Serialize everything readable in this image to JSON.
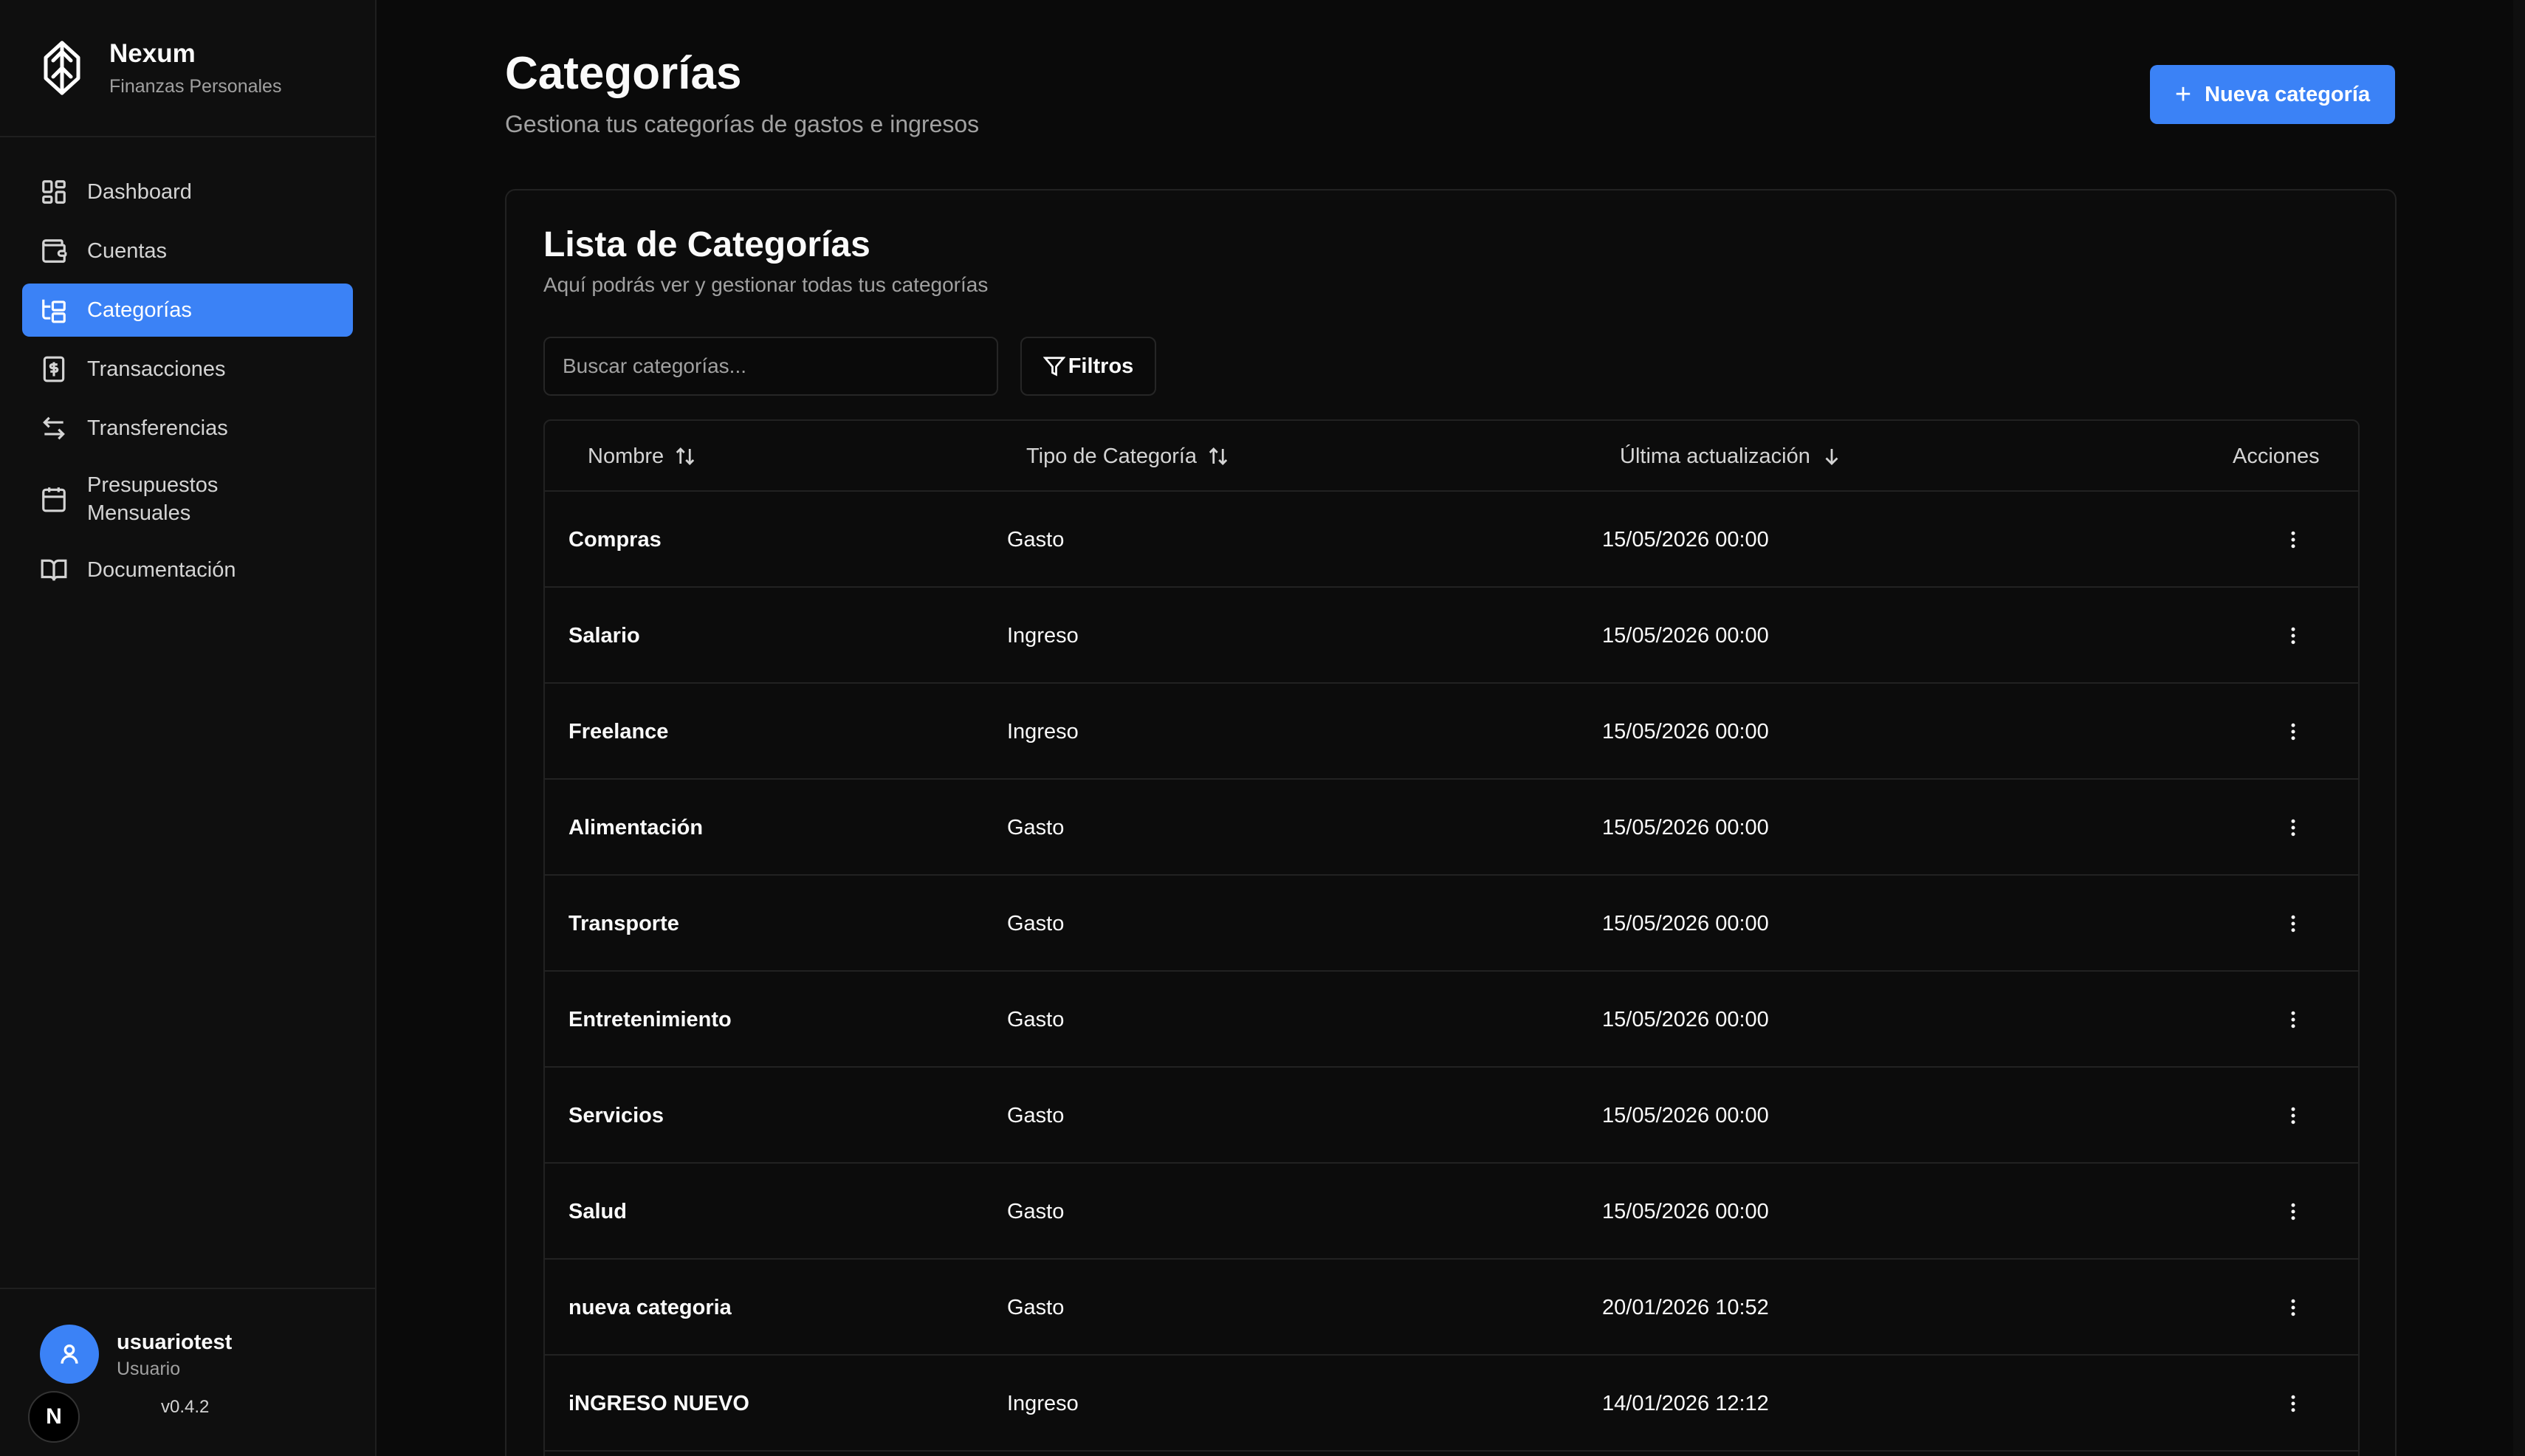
{
  "app": {
    "name": "Nexum",
    "subtitle": "Finanzas Personales",
    "version": "v0.4.2"
  },
  "sidebar": {
    "items": [
      {
        "label": "Dashboard",
        "icon": "dashboard-icon"
      },
      {
        "label": "Cuentas",
        "icon": "wallet-icon"
      },
      {
        "label": "Categorías",
        "icon": "tree-icon",
        "active": true
      },
      {
        "label": "Transacciones",
        "icon": "receipt-dollar-icon"
      },
      {
        "label": "Transferencias",
        "icon": "arrows-exchange-icon"
      },
      {
        "label": "Presupuestos\nMensuales",
        "icon": "calendar-icon"
      },
      {
        "label": "Documentación",
        "icon": "book-icon"
      }
    ]
  },
  "user": {
    "name": "usuariotest",
    "role": "Usuario",
    "badge": "N"
  },
  "page": {
    "title": "Categorías",
    "subtitle": "Gestiona tus categorías de gastos e ingresos",
    "new_button": "Nueva categoría"
  },
  "card": {
    "title": "Lista de Categorías",
    "subtitle": "Aquí podrás ver y gestionar todas tus categorías",
    "search_placeholder": "Buscar categorías...",
    "filters_label": "Filtros"
  },
  "table": {
    "columns": {
      "name": "Nombre",
      "type": "Tipo de Categoría",
      "updated": "Última actualización",
      "actions": "Acciones"
    },
    "rows": [
      {
        "name": "Compras",
        "type": "Gasto",
        "updated": "15/05/2026 00:00"
      },
      {
        "name": "Salario",
        "type": "Ingreso",
        "updated": "15/05/2026 00:00"
      },
      {
        "name": "Freelance",
        "type": "Ingreso",
        "updated": "15/05/2026 00:00"
      },
      {
        "name": "Alimentación",
        "type": "Gasto",
        "updated": "15/05/2026 00:00"
      },
      {
        "name": "Transporte",
        "type": "Gasto",
        "updated": "15/05/2026 00:00"
      },
      {
        "name": "Entretenimiento",
        "type": "Gasto",
        "updated": "15/05/2026 00:00"
      },
      {
        "name": "Servicios",
        "type": "Gasto",
        "updated": "15/05/2026 00:00"
      },
      {
        "name": "Salud",
        "type": "Gasto",
        "updated": "15/05/2026 00:00"
      },
      {
        "name": "nueva categoria",
        "type": "Gasto",
        "updated": "20/01/2026 10:52"
      },
      {
        "name": "iNGRESO NUEVO",
        "type": "Ingreso",
        "updated": "14/01/2026 12:12"
      }
    ]
  },
  "colors": {
    "accent": "#3b82f6",
    "background": "#0a0a0a",
    "sidebar": "#0f0f0f",
    "border": "#222222"
  }
}
